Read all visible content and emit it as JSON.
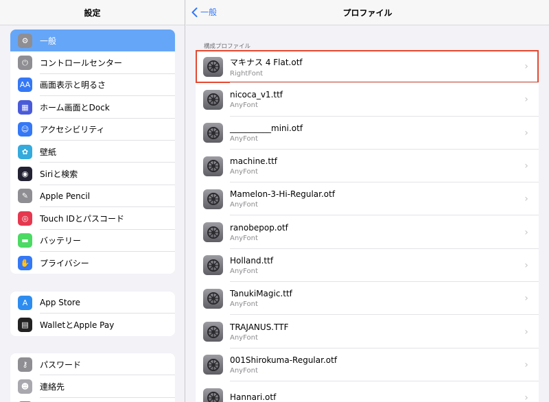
{
  "sidebar": {
    "title": "設定",
    "group1": [
      {
        "label": "一般",
        "icon": "gear-icon",
        "color": "#8e8e93",
        "glyph": "⚙"
      },
      {
        "label": "コントロールセンター",
        "icon": "toggles-icon",
        "color": "#8e8e93",
        "glyph": "⏻"
      },
      {
        "label": "画面表示と明るさ",
        "icon": "text-size-icon",
        "color": "#3478f6",
        "glyph": "AA"
      },
      {
        "label": "ホーム画面とDock",
        "icon": "home-grid-icon",
        "color": "#4a5bd9",
        "glyph": "▦"
      },
      {
        "label": "アクセシビリティ",
        "icon": "accessibility-icon",
        "color": "#3478f6",
        "glyph": "☺"
      },
      {
        "label": "壁紙",
        "icon": "flower-icon",
        "color": "#35aadc",
        "glyph": "✿"
      },
      {
        "label": "Siriと検索",
        "icon": "siri-icon",
        "color": "#222233",
        "glyph": "◉"
      },
      {
        "label": "Apple Pencil",
        "icon": "pencil-icon",
        "color": "#8e8e93",
        "glyph": "✎"
      },
      {
        "label": "Touch IDとパスコード",
        "icon": "fingerprint-icon",
        "color": "#e5384f",
        "glyph": "◎"
      },
      {
        "label": "バッテリー",
        "icon": "battery-icon",
        "color": "#4cd964",
        "glyph": "▬"
      },
      {
        "label": "プライバシー",
        "icon": "hand-icon",
        "color": "#3478f6",
        "glyph": "✋"
      }
    ],
    "group2": [
      {
        "label": "App Store",
        "icon": "app-store-icon",
        "color": "#2d8cf0",
        "glyph": "A"
      },
      {
        "label": "WalletとApple Pay",
        "icon": "wallet-icon",
        "color": "#222222",
        "glyph": "▤"
      }
    ],
    "group3": [
      {
        "label": "パスワード",
        "icon": "key-icon",
        "color": "#8e8e93",
        "glyph": "⚷"
      },
      {
        "label": "連絡先",
        "icon": "contacts-icon",
        "color": "#a8a8ae",
        "glyph": "☻"
      },
      {
        "label": "",
        "icon": "calendar-icon",
        "color": "#e8524a",
        "glyph": ""
      }
    ]
  },
  "main": {
    "back_label": "一般",
    "title": "プロファイル",
    "section_header": "構成プロファイル",
    "profiles": [
      {
        "name": "マキナス 4 Flat.otf",
        "subtitle": "RightFont"
      },
      {
        "name": "nicoca_v1.ttf",
        "subtitle": "AnyFont"
      },
      {
        "name": "__________mini.otf",
        "subtitle": "AnyFont"
      },
      {
        "name": "machine.ttf",
        "subtitle": "AnyFont"
      },
      {
        "name": "Mamelon-3-Hi-Regular.otf",
        "subtitle": "AnyFont"
      },
      {
        "name": "ranobepop.otf",
        "subtitle": "AnyFont"
      },
      {
        "name": "Holland.ttf",
        "subtitle": "AnyFont"
      },
      {
        "name": "TanukiMagic.ttf",
        "subtitle": "AnyFont"
      },
      {
        "name": "TRAJANUS.TTF",
        "subtitle": "AnyFont"
      },
      {
        "name": "001Shirokuma-Regular.otf",
        "subtitle": "AnyFont"
      },
      {
        "name": "Hannari.otf",
        "subtitle": ""
      }
    ]
  }
}
